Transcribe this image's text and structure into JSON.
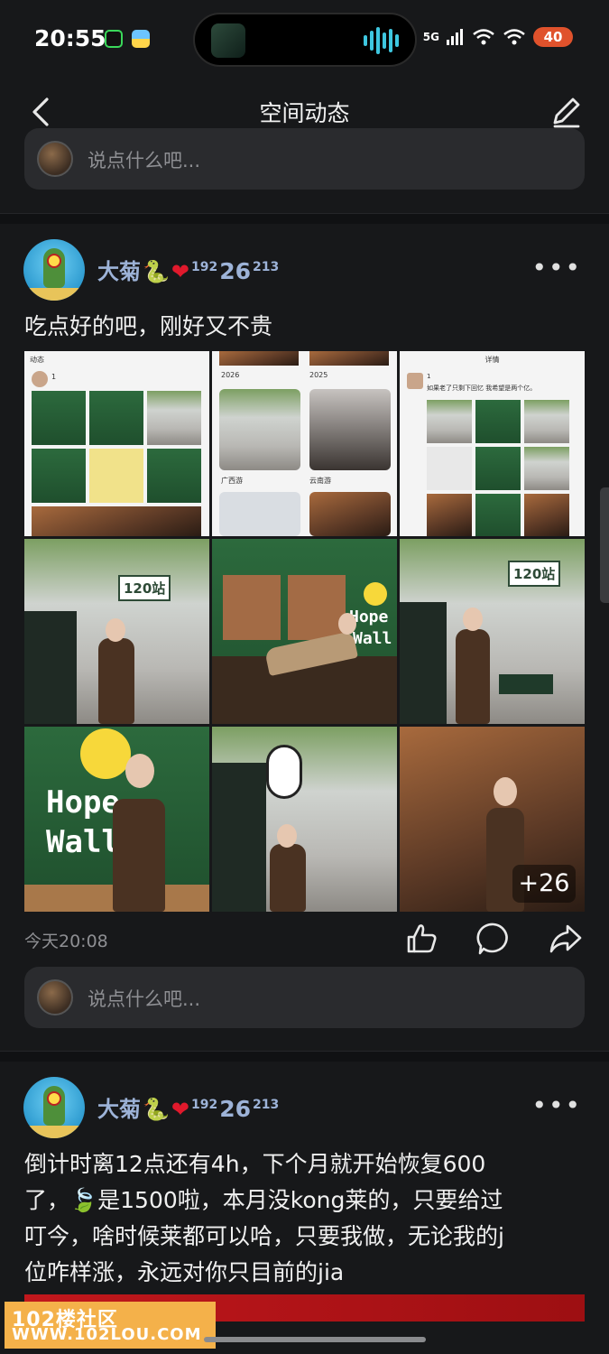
{
  "status_bar": {
    "time": "20:55",
    "network": "5G",
    "battery": "40"
  },
  "nav": {
    "title": "空间动态"
  },
  "comment_placeholder": "说点什么吧...",
  "posts": [
    {
      "username": "大菊",
      "name_suffix_sup1": "192",
      "name_suffix_num": "26",
      "name_suffix_sup2": "213",
      "text": "吃点好的吧，刚好又不贵",
      "time": "今天20:08",
      "more_photos": "+26",
      "screenshot_texts": {
        "s1_header": "动态",
        "s1_count": "1",
        "s2_years": [
          "2026",
          "2025"
        ],
        "s2_labels": [
          "广西游",
          "云南游"
        ],
        "s3_header": "详情",
        "s3_count": "1",
        "s3_line": "如果老了只剩下回忆 我希望是两个亿。"
      },
      "sign_text": "120站",
      "wall_text": [
        "Hope",
        "Wall"
      ]
    },
    {
      "username": "大菊",
      "name_suffix_sup1": "192",
      "name_suffix_num": "26",
      "name_suffix_sup2": "213",
      "text_lines": [
        "倒计时离12点还有4h，下个月就开始恢复600",
        "了，🍃是1500啦，本月没kong莱的，只要给过",
        "叮今，啥时候莱都可以哈，只要我做，无论我的j",
        "位咋样涨，永远对你只目前的jia"
      ]
    }
  ],
  "watermark": {
    "line1": "102楼社区",
    "line2": "WWW.102LOU.COM"
  },
  "colors": {
    "background": "#17181a",
    "card": "#2a2b2e",
    "username": "#9db3d8",
    "battery": "#e0522c"
  }
}
